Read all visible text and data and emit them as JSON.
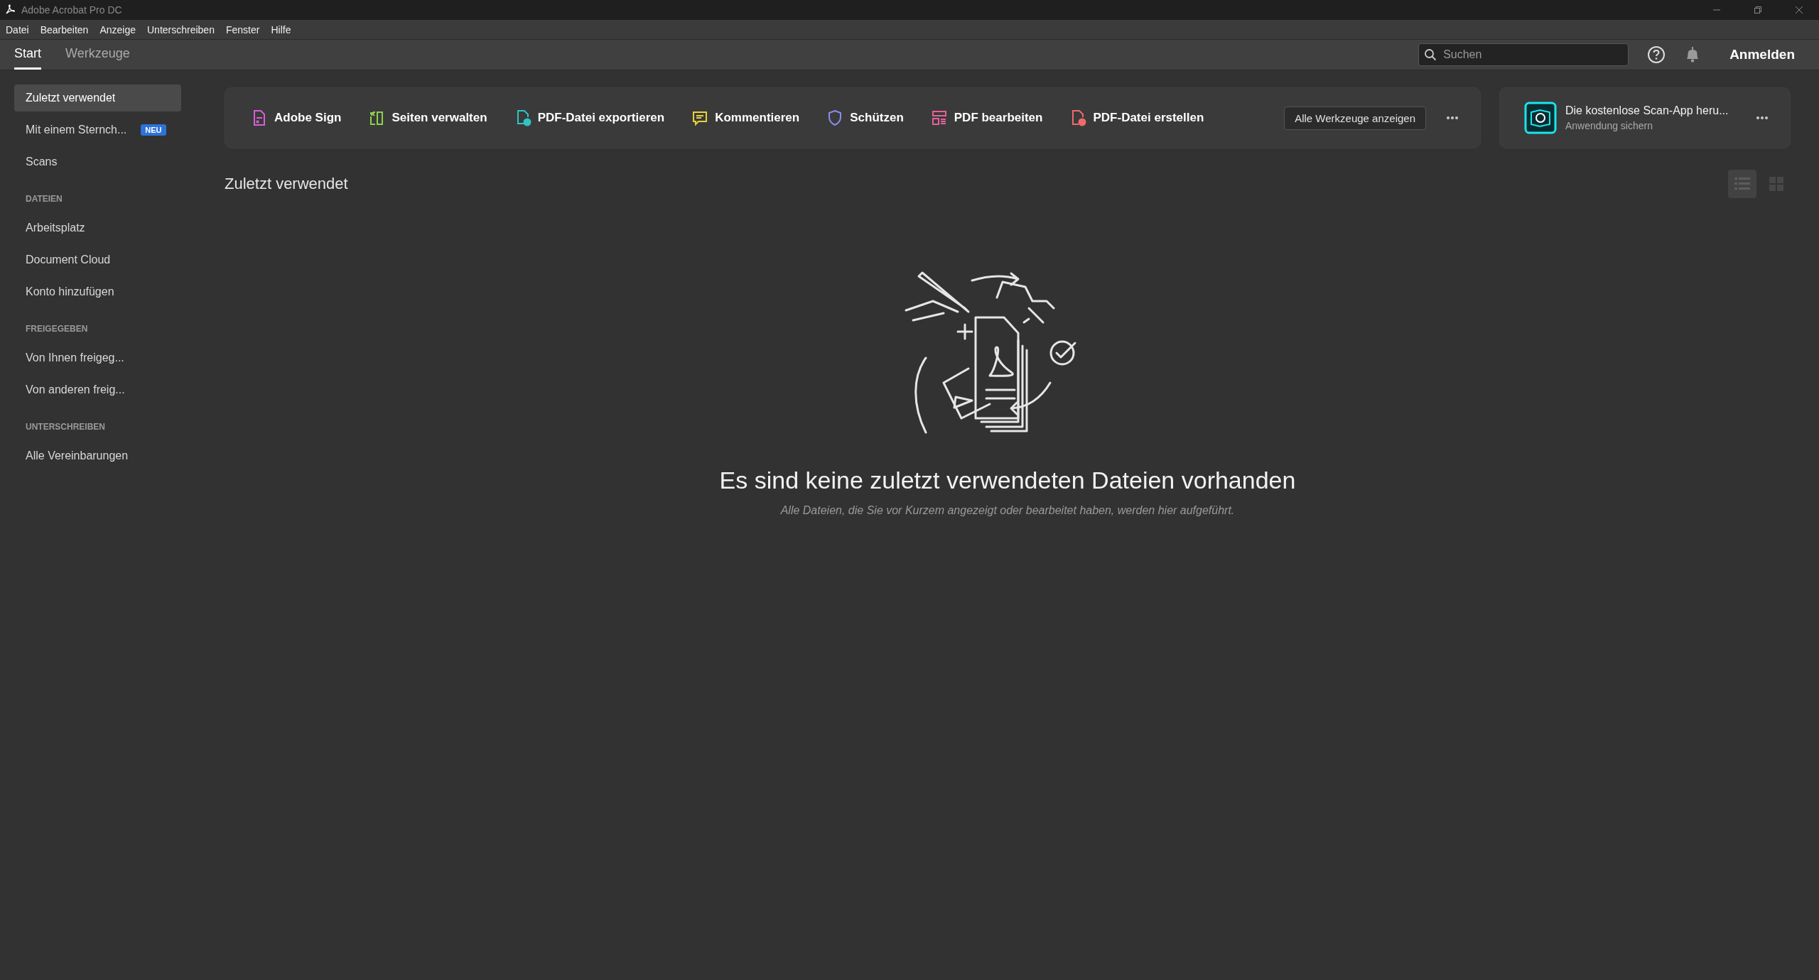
{
  "window": {
    "title": "Adobe Acrobat Pro DC"
  },
  "menu": [
    "Datei",
    "Bearbeiten",
    "Anzeige",
    "Unterschreiben",
    "Fenster",
    "Hilfe"
  ],
  "tabs": [
    {
      "label": "Start",
      "selected": true
    },
    {
      "label": "Werkzeuge",
      "selected": false
    }
  ],
  "search": {
    "placeholder": "Suchen"
  },
  "sign_in": "Anmelden",
  "sidebar": {
    "sections": [
      {
        "items": [
          {
            "label": "Zuletzt verwendet",
            "selected": true
          },
          {
            "label": "Mit einem Sternch...",
            "selected": false,
            "badge": "NEU"
          },
          {
            "label": "Scans",
            "selected": false
          }
        ]
      },
      {
        "heading": "DATEIEN",
        "items": [
          {
            "label": "Arbeitsplatz",
            "selected": false
          },
          {
            "label": "Document Cloud",
            "selected": false
          },
          {
            "label": "Konto hinzufügen",
            "selected": false
          }
        ]
      },
      {
        "heading": "FREIGEGEBEN",
        "items": [
          {
            "label": "Von Ihnen freigeg...",
            "selected": false
          },
          {
            "label": "Von anderen freig...",
            "selected": false
          }
        ]
      },
      {
        "heading": "UNTERSCHREIBEN",
        "items": [
          {
            "label": "Alle Vereinbarungen",
            "selected": false
          }
        ]
      }
    ]
  },
  "tools": [
    {
      "label": "Adobe Sign",
      "kind": "sign",
      "color": "#d55fd8"
    },
    {
      "label": "Seiten verwalten",
      "kind": "pages",
      "color": "#8fd14f"
    },
    {
      "label": "PDF-Datei exportieren",
      "kind": "export",
      "color": "#2ec4c4"
    },
    {
      "label": "Kommentieren",
      "kind": "comment",
      "color": "#e8d23a"
    },
    {
      "label": "Schützen",
      "kind": "protect",
      "color": "#8a8cf0"
    },
    {
      "label": "PDF bearbeiten",
      "kind": "edit",
      "color": "#e8609a"
    },
    {
      "label": "PDF-Datei erstellen",
      "kind": "create",
      "color": "#ee6b6b"
    }
  ],
  "all_tools_button": "Alle Werkzeuge anzeigen",
  "promo": {
    "title": "Die kostenlose Scan-App heru...",
    "subtitle": "Anwendung sichern"
  },
  "section_title": "Zuletzt verwendet",
  "view_modes": [
    {
      "kind": "list",
      "selected": true
    },
    {
      "kind": "grid",
      "selected": false
    }
  ],
  "empty_state": {
    "title": "Es sind keine zuletzt verwendeten Dateien vorhanden",
    "subtitle": "Alle Dateien, die Sie vor Kurzem angezeigt oder bearbeitet haben, werden hier aufgeführt."
  }
}
